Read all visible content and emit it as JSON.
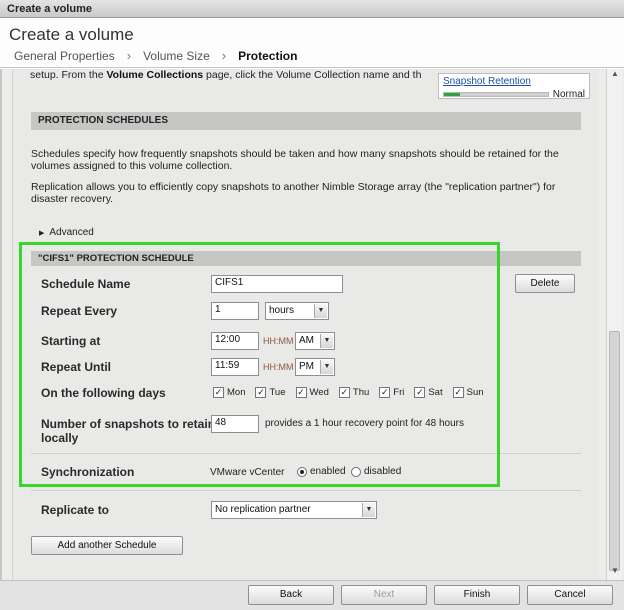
{
  "window": {
    "title": "Create a volume"
  },
  "wizard": {
    "heading": "Create a volume",
    "steps": [
      "General Properties",
      "Volume Size",
      "Protection"
    ],
    "active_step": 2,
    "separator": "›"
  },
  "intro": {
    "text_before": "setup. From the ",
    "text_bold": "Volume Collections",
    "text_after": " page, click the Volume Collection name and th"
  },
  "retention": {
    "link": "Snapshot Retention",
    "status": "Normal",
    "level": 0.15
  },
  "protection": {
    "section_title": "PROTECTION SCHEDULES",
    "para1": "Schedules specify how frequently snapshots should be taken and how many snapshots should be retained for the volumes assigned to this volume collection.",
    "para2": "Replication allows you to efficiently copy snapshots to another Nimble Storage array (the \"replication partner\") for disaster recovery.",
    "advanced_label": "Advanced"
  },
  "schedule": {
    "section_title": "\"CIFS1\" PROTECTION SCHEDULE",
    "delete_label": "Delete",
    "name": {
      "label": "Schedule Name",
      "value": "CIFS1"
    },
    "repeat_every": {
      "label": "Repeat Every",
      "value": "1",
      "unit": "hours"
    },
    "starting_at": {
      "label": "Starting at",
      "time": "12:00",
      "format": "HH:MM",
      "ampm": "AM"
    },
    "repeat_until": {
      "label": "Repeat Until",
      "time": "11:59",
      "format": "HH:MM",
      "ampm": "PM"
    },
    "days": {
      "label": "On the following days",
      "items": [
        {
          "label": "Mon",
          "checked": true
        },
        {
          "label": "Tue",
          "checked": true
        },
        {
          "label": "Wed",
          "checked": true
        },
        {
          "label": "Thu",
          "checked": true
        },
        {
          "label": "Fri",
          "checked": true
        },
        {
          "label": "Sat",
          "checked": true
        },
        {
          "label": "Sun",
          "checked": true
        }
      ]
    },
    "retain": {
      "label_line1": "Number of snapshots to retain",
      "label_line2": "locally",
      "value": "48",
      "recovery_text": "provides a 1 hour recovery point for 48 hours"
    },
    "sync": {
      "label": "Synchronization",
      "vmware_label": "VMware vCenter",
      "enabled_label": "enabled",
      "disabled_label": "disabled",
      "selected": "enabled"
    }
  },
  "replicate": {
    "label": "Replicate to",
    "value": "No replication partner"
  },
  "add_schedule_label": "Add another Schedule",
  "footer": {
    "back": "Back",
    "next": "Next",
    "finish": "Finish",
    "cancel": "Cancel"
  },
  "colors": {
    "highlight": "#36d62a",
    "retention_fill": "#2ea33a",
    "link": "#1f4fa0"
  }
}
